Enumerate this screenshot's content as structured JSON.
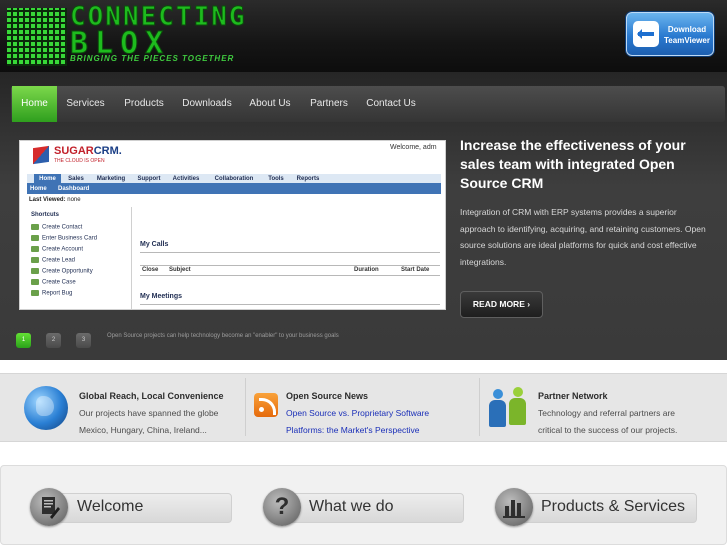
{
  "header": {
    "logo_line1": "CONNECTING",
    "logo_line2": "BLOX",
    "tagline": "BRINGING THE PIECES TOGETHER",
    "teamviewer_label": "Download TeamViewer"
  },
  "nav": {
    "items": [
      "Home",
      "Services",
      "Products",
      "Downloads",
      "About Us",
      "Partners",
      "Contact Us"
    ],
    "active": "Home"
  },
  "slide": {
    "crm": {
      "logo_a": "SUGAR",
      "logo_b": "CRM.",
      "tagline": "THE CLOUD IS OPEN",
      "welcome": "Welcome, adm",
      "tabs": [
        "Home",
        "Sales",
        "Marketing",
        "Support",
        "Activities",
        "Collaboration",
        "Tools",
        "Reports"
      ],
      "subtabs": [
        "Home",
        "Dashboard"
      ],
      "last_viewed_label": "Last Viewed:",
      "last_viewed_value": "none",
      "shortcuts_title": "Shortcuts",
      "shortcuts": [
        "Create Contact",
        "Enter Business Card",
        "Create Account",
        "Create Lead",
        "Create Opportunity",
        "Create Case",
        "Report Bug"
      ],
      "my_calls": "My Calls",
      "calls_cols": [
        "Close",
        "Subject",
        "Duration",
        "Start Date"
      ],
      "my_meetings": "My Meetings"
    },
    "title": "Increase the effectiveness of your sales team with integrated Open Source CRM",
    "description": "Integration of CRM with ERP systems provides a superior approach to identifying, acquiring, and retaining customers. Open source solutions are ideal platforms for quick and cost effective integrations.",
    "read_more": "READ MORE ›",
    "pager": [
      "1",
      "2",
      "3"
    ],
    "caption": "Open Source projects can help technology become an \"enabler\" to your business goals"
  },
  "features": {
    "global": {
      "title": "Global Reach, Local Convenience",
      "line1": "Our projects have spanned the globe",
      "line2": "Mexico, Hungary, China, Ireland..."
    },
    "news": {
      "title": "Open Source News",
      "link1": "Open Source vs. Proprietary Software",
      "link2": "Platforms: the Market's Perspective"
    },
    "partner": {
      "title": "Partner Network",
      "line1": "Technology and referral partners are",
      "line2": "critical to the success of our projects."
    }
  },
  "bottom": {
    "welcome": "Welcome",
    "what_we_do": "What we do",
    "products": "Products & Services"
  }
}
